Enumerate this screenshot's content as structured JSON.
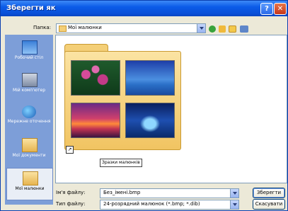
{
  "window": {
    "title": "Зберегти як",
    "help_label": "?",
    "close_label": "✕"
  },
  "toolbar": {
    "location_label": "Папка:",
    "location_value": "Мої малюнки",
    "icons": [
      "back-icon",
      "up-folder-icon",
      "new-folder-icon",
      "views-icon"
    ]
  },
  "places": [
    {
      "label": "Робочий стіл",
      "icon": "desktop-icon"
    },
    {
      "label": "Мій комп'ютер",
      "icon": "computer-icon"
    },
    {
      "label": "Мережне оточення",
      "icon": "network-icon"
    },
    {
      "label": "Мої документи",
      "icon": "documents-icon"
    },
    {
      "label": "Мої малюнки",
      "icon": "pictures-icon",
      "active": true
    }
  ],
  "files": [
    {
      "name": "Зразки малюнків",
      "type": "folder-shortcut"
    }
  ],
  "filename": {
    "label": "Ім'я файлу:",
    "value": "Без_імені.bmp"
  },
  "filetype": {
    "label": "Тип файлу:",
    "value": "24-розрядний малюнок (*.bmp; *.dib)"
  },
  "buttons": {
    "save": "Зберегти",
    "cancel": "Скасувати"
  },
  "colors": {
    "titlebar": "#0b5be8",
    "places_bar": "#7d9ed8",
    "folder": "#f4cf77"
  }
}
